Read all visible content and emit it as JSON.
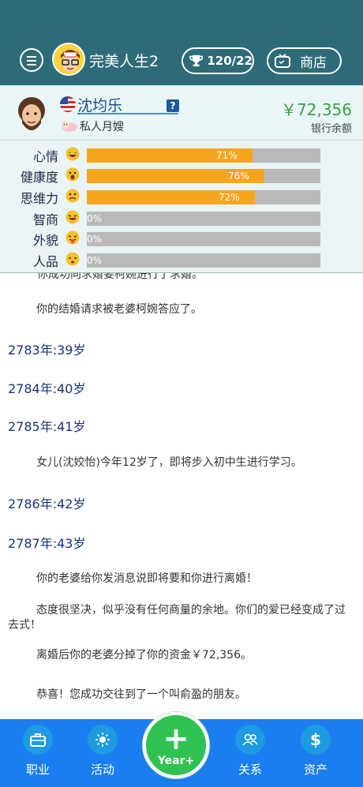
{
  "header": {
    "title": "完美人生2",
    "trophy_count": "120/22",
    "shop_label": "商店"
  },
  "profile": {
    "name": "沈均乐",
    "help": "?",
    "job": "私人月嫂",
    "balance": "￥72,356",
    "balance_label": "银行余额"
  },
  "stats": [
    {
      "label": "心情",
      "value": 71,
      "text": "71%"
    },
    {
      "label": "健康度",
      "value": 76,
      "text": "76%"
    },
    {
      "label": "思维力",
      "value": 72,
      "text": "72%"
    },
    {
      "label": "智商",
      "value": 0,
      "text": "0%"
    },
    {
      "label": "外貌",
      "value": 0,
      "text": "0%"
    },
    {
      "label": "人品",
      "value": 0,
      "text": "0%"
    }
  ],
  "log": {
    "clipped": "你成功向求婚要柯婉进行了求婚。",
    "e1": "你的结婚请求被老婆柯婉答应了。",
    "y1": "2783年:39岁",
    "y2": "2784年:40岁",
    "y3": "2785年:41岁",
    "e2": "女儿(沈姣怡)今年12岁了，即将步入初中生进行学习。",
    "y4": "2786年:42岁",
    "y5": "2787年:43岁",
    "e3": "你的老婆给你发消息说即将要和你进行离婚！",
    "e4": "态度很坚决，似乎没有任何商量的余地。你们的爱已经变成了过去式！",
    "e5": "离婚后你的老婆分掉了你的资金￥72,356。",
    "e6": "恭喜！您成功交往到了一个叫俞盈的朋友。"
  },
  "nav": {
    "job": "职业",
    "activity": "活动",
    "year_plus": "+",
    "year": "Year+",
    "relation": "关系",
    "assets": "资产"
  }
}
